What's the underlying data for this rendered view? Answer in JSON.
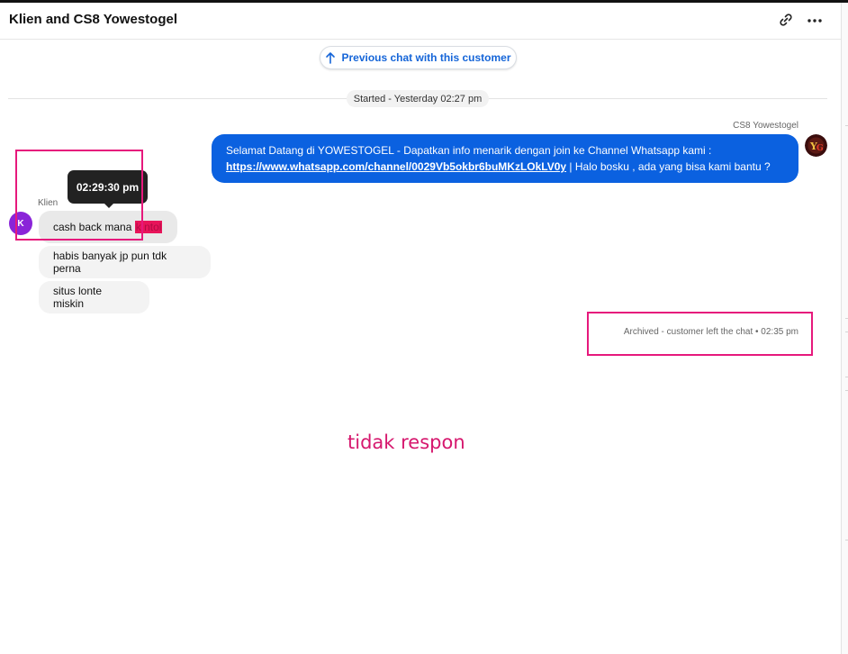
{
  "header": {
    "title": "Klien and CS8 Yowestogel",
    "link_icon": "link-icon",
    "more_icon": "more-horizontal-icon"
  },
  "chat": {
    "previous_chat_label": "Previous chat with this customer",
    "started_label": "Started - Yesterday 02:27 pm",
    "agent": {
      "name": "CS8 Yowestogel",
      "message_prefix": "Selamat Datang di YOWESTOGEL - Dapatkan info menarik dengan join ke Channel Whatsapp kami :",
      "message_link": "https://www.whatsapp.com/channel/0029Vb5okbr6buMKzLOkLV0y",
      "message_suffix": " | Halo bosku , ada yang bisa kami bantu ?"
    },
    "client": {
      "name": "Klien",
      "initial": "K",
      "messages": [
        {
          "text_before": "cash back mana",
          "text_redacted": "k ntol"
        },
        {
          "text": "habis banyak jp pun tdk perna"
        },
        {
          "text": "situs lonte miskin"
        }
      ],
      "tooltip_time": "02:29:30 pm"
    },
    "archived_note": "Archived - customer left the chat • 02:35 pm"
  },
  "annotation": {
    "note": "tidak respon",
    "color": "#e6197c"
  },
  "colors": {
    "agent_bubble": "#0b61e0",
    "client_avatar": "#8a24d8",
    "link": "#1565d8"
  }
}
